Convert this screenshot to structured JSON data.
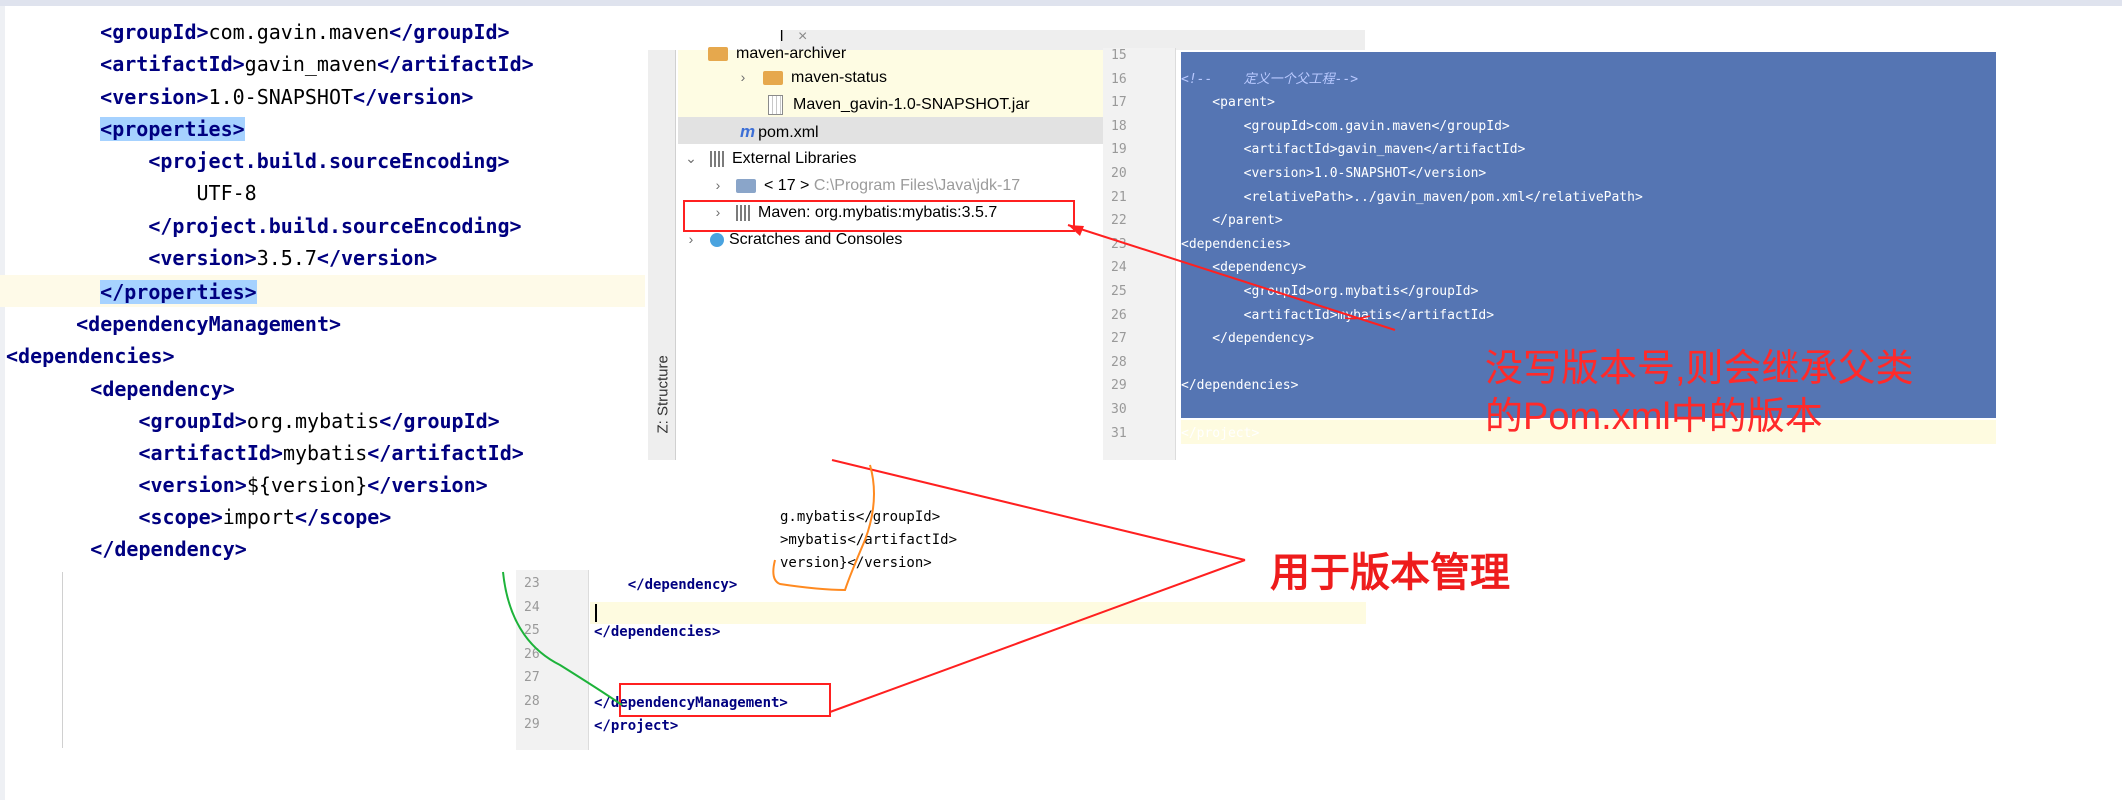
{
  "left_xml": [
    {
      "indent": "    ",
      "open": "<groupId>",
      "text": "com.gavin.maven",
      "close": "</groupId>"
    },
    {
      "indent": "    ",
      "open": "<artifactId>",
      "text": "gavin_maven",
      "close": "</artifactId>"
    },
    {
      "indent": "    ",
      "open": "<version>",
      "text": "1.0-SNAPSHOT",
      "close": "</version>"
    },
    {
      "indent": "    ",
      "open": "<properties>",
      "text": "",
      "close": ""
    },
    {
      "indent": "        ",
      "open": "<project.build.sourceEncoding>",
      "text": "",
      "close": ""
    },
    {
      "indent": "            ",
      "open": "",
      "text": "UTF-8",
      "close": ""
    },
    {
      "indent": "        ",
      "open": "",
      "text": "",
      "close": "</project.build.sourceEncoding>"
    },
    {
      "indent": "        ",
      "open": "<version>",
      "text": "3.5.7",
      "close": "</version>"
    },
    {
      "indent": "    ",
      "open": "",
      "text": "",
      "close": "</properties>"
    },
    {
      "indent": "   ",
      "open": "<dependencyManagement>",
      "text": "",
      "close": ""
    },
    {
      "indent": "",
      "open": "<dependencies>",
      "text": "",
      "close": ""
    },
    {
      "indent": "       ",
      "open": "<dependency>",
      "text": "",
      "close": ""
    },
    {
      "indent": "           ",
      "open": "<groupId>",
      "text": "org.mybatis",
      "close": "</groupId>"
    },
    {
      "indent": "           ",
      "open": "<artifactId>",
      "text": "mybatis",
      "close": "</artifactId>"
    },
    {
      "indent": "           ",
      "open": "<version>",
      "text": "${version}",
      "close": "</version>"
    },
    {
      "indent": "           ",
      "open": "<scope>",
      "text": "import",
      "close": "</scope>"
    },
    {
      "indent": "       ",
      "open": "",
      "text": "",
      "close": "</dependency>"
    }
  ],
  "tree": {
    "tab_label": "l",
    "items": [
      {
        "label": "maven-archiver",
        "kind": "folder"
      },
      {
        "label": "maven-status",
        "kind": "folder"
      },
      {
        "label": "Maven_gavin-1.0-SNAPSHOT.jar",
        "kind": "jar"
      },
      {
        "label": "pom.xml",
        "kind": "pom"
      },
      {
        "label": "External Libraries",
        "kind": "lib"
      },
      {
        "label": "< 17 >",
        "extra": "C:\\Program Files\\Java\\jdk-17",
        "kind": "jdk"
      },
      {
        "label": "Maven: org.mybatis:mybatis:3.5.7",
        "kind": "lib"
      },
      {
        "label": "Scratches and Consoles",
        "kind": "scratch"
      }
    ],
    "structure_label": "Z: Structure"
  },
  "right_code": {
    "line_numbers": [
      "15",
      "16",
      "17",
      "18",
      "19",
      "20",
      "21",
      "22",
      "23",
      "24",
      "25",
      "26",
      "27",
      "28",
      "29",
      "30",
      "31"
    ],
    "lines": [
      "",
      "<!--    定义一个父工程-->",
      "    <parent>",
      "        <groupId>com.gavin.maven</groupId>",
      "        <artifactId>gavin_maven</artifactId>",
      "        <version>1.0-SNAPSHOT</version>",
      "        <relativePath>../gavin_maven/pom.xml</relativePath>",
      "    </parent>",
      "<dependencies>",
      "    <dependency>",
      "        <groupId>org.mybatis</groupId>",
      "        <artifactId>mybatis</artifactId>",
      "    </dependency>",
      "",
      "</dependencies>",
      "",
      "</project>"
    ]
  },
  "bottom_snippet": {
    "partial_lines": [
      "g.mybatis</groupId>",
      ">mybatis</artifactId>",
      "version}</version>"
    ],
    "line_numbers": [
      "23",
      "24",
      "25",
      "26",
      "27",
      "28",
      "29"
    ],
    "lines": [
      "    </dependency>",
      "",
      "</dependencies>",
      "",
      "",
      "</dependencyManagement>",
      "</project>"
    ]
  },
  "annotations": {
    "note_line1": "没写版本号,则会继承父类",
    "note_line2": "的Pom.xml中的版本",
    "version_mgmt": "用于版本管理"
  },
  "colors": {
    "accent_red": "#ff2a2a",
    "selection_blue": "#5575b3",
    "tag_navy": "#000080"
  }
}
